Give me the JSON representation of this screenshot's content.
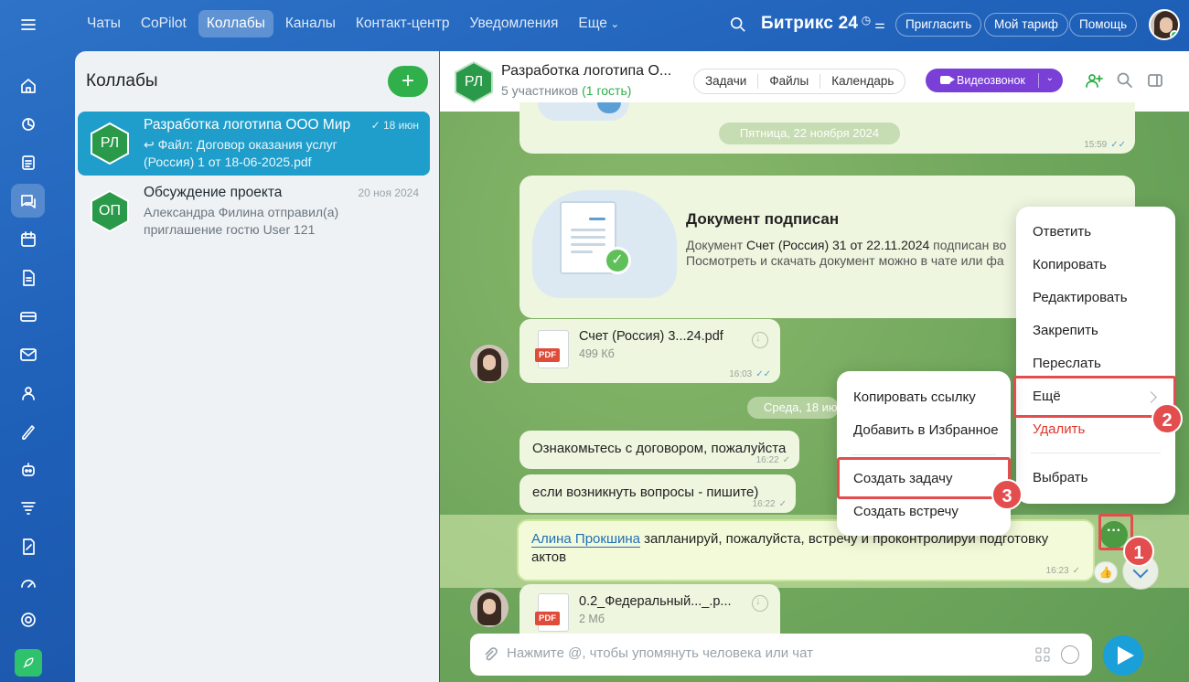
{
  "topnav": {
    "items": [
      "Чаты",
      "CoPilot",
      "Коллабы",
      "Каналы",
      "Контакт-центр",
      "Уведомления",
      "Еще"
    ],
    "brand": "Битрикс 24",
    "invite": "Пригласить",
    "tariff": "Мой тариф",
    "help": "Помощь"
  },
  "sidebar": {
    "title": "Коллабы",
    "chats": [
      {
        "initials": "РЛ",
        "title": "Разработка логотипа ООО Мир",
        "preview_line1": "↩ Файл: Договор оказания услуг",
        "preview_line2": "(Россия) 1 от 18-06-2025.pdf",
        "date": "18 июн"
      },
      {
        "initials": "ОП",
        "title": "Обсуждение проекта",
        "preview_line1": "Александра Филина отправил(а)",
        "preview_line2": "приглашение гостю User 121",
        "date": "20 ноя 2024"
      }
    ]
  },
  "chat": {
    "initials": "РЛ",
    "title": "Разработка логотипа О...",
    "members": "5 участников",
    "guests": "(1 гость)",
    "tabs": [
      "Задачи",
      "Файлы",
      "Календарь"
    ],
    "video_call": "Видеозвонок",
    "date_friday": "Пятница, 22 ноября 2024",
    "date_wednesday": "Среда, 18 ию",
    "top_time": "15:59",
    "doc": {
      "title": "Документ подписан",
      "desc_prefix": "Документ ",
      "desc_name": "Счет (Россия) 31 от 22.11.2024",
      "desc_suffix": " подписан во",
      "desc_line2": "Посмотреть и скачать документ можно в чате или фа"
    },
    "file1": {
      "name": "Счет (Россия) 3...24.pdf",
      "size": "499 Кб",
      "time": "16:03",
      "type": "PDF"
    },
    "msg1": {
      "text": "Ознакомьтесь с договором, пожалуйста",
      "time": "16:22"
    },
    "msg2": {
      "text": "если возникнуть вопросы - пишите)",
      "time": "16:22"
    },
    "msg3": {
      "mention": "Алина Прокшина",
      "text": " запланируй, пожалуйста, встречу и проконтролируй подготовку",
      "text2": "актов",
      "time": "16:23"
    },
    "file2": {
      "name": "0.2_Федеральный..._.р...",
      "size": "2 Мб",
      "type": "PDF"
    },
    "input_placeholder": "Нажмите @, чтобы упомянуть человека или чат"
  },
  "context_menu": {
    "items": [
      "Ответить",
      "Копировать",
      "Редактировать",
      "Закрепить",
      "Переслать",
      "Ещё",
      "Удалить",
      "Выбрать"
    ]
  },
  "submenu": {
    "items": [
      "Копировать ссылку",
      "Добавить в Избранное",
      "Создать задачу",
      "Создать встречу"
    ]
  },
  "badges": [
    "1",
    "2",
    "3"
  ],
  "colors": {
    "accent": "#1f9ecb",
    "green": "#2fb04a",
    "highlight": "#e34d4d",
    "danger": "#e0372b"
  }
}
